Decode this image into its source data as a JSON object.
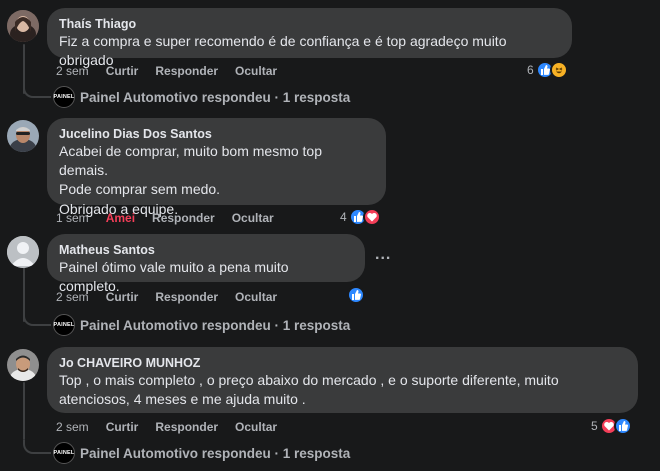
{
  "comments": [
    {
      "author": "Thaís Thiago",
      "text_lines": [
        "Fiz a compra e super recomendo é de confiança e é top agradeço muito obrigado"
      ],
      "time": "2 sem",
      "actions": {
        "like": "Curtir",
        "reply": "Responder",
        "hide": "Ocultar"
      },
      "reaction_count": "6",
      "reactions": [
        "like-icon",
        "haha-icon"
      ],
      "reply_summary": "Painel Automotivo respondeu · 1 resposta"
    },
    {
      "author": "Jucelino Dias Dos Santos",
      "text_lines": [
        "Acabei de comprar, muito bom mesmo top demais.",
        "Pode comprar sem medo.",
        "Obrigado a equipe."
      ],
      "time": "1 sem",
      "actions": {
        "like": "Amei",
        "reply": "Responder",
        "hide": "Ocultar"
      },
      "reaction_count": "4",
      "reactions": [
        "like-icon",
        "love-icon"
      ]
    },
    {
      "author": "Matheus Santos",
      "text_lines": [
        "Painel ótimo vale muito a pena muito completo."
      ],
      "time": "2 sem",
      "actions": {
        "like": "Curtir",
        "reply": "Responder",
        "hide": "Ocultar"
      },
      "reaction_count": "",
      "reactions": [
        "like-icon"
      ],
      "more": "...",
      "reply_summary": "Painel Automotivo respondeu · 1 resposta"
    },
    {
      "author": "Jo CHAVEIRO MUNHOZ",
      "text_lines": [
        "Top , o mais completo , o preço abaixo do mercado , e o suporte diferente, muito",
        "atenciosos, 4 meses e me ajuda muito ."
      ],
      "time": "2 sem",
      "actions": {
        "like": "Curtir",
        "reply": "Responder",
        "hide": "Ocultar"
      },
      "reaction_count": "5",
      "reactions": [
        "love-icon",
        "like-icon"
      ],
      "reply_summary": "Painel Automotivo respondeu · 1 resposta"
    }
  ],
  "page_avatar_text": "PAINEL",
  "colors": {
    "background": "#18191a",
    "bubble": "#3a3b3c",
    "like": "#2d88ff",
    "love": "#f33e58",
    "haha": "#f7b125",
    "muted": "#b0b3b8"
  }
}
